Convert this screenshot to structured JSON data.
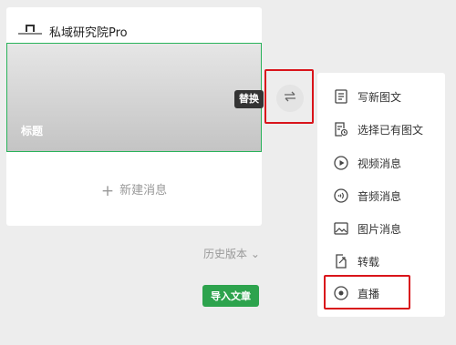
{
  "account": {
    "name": "私域研究院Pro"
  },
  "article": {
    "cover_title": "标题"
  },
  "new_message": {
    "label": "新建消息",
    "icon": "plus-icon"
  },
  "history": {
    "label": "历史版本 ⌄"
  },
  "import_button": {
    "label": "导入文章"
  },
  "swap": {
    "tooltip": "替换",
    "icon": "swap-arrows-icon"
  },
  "menu": {
    "items": [
      {
        "label": "写新图文",
        "icon": "document-icon"
      },
      {
        "label": "选择已有图文",
        "icon": "document-search-icon"
      },
      {
        "label": "视频消息",
        "icon": "play-circle-icon"
      },
      {
        "label": "音频消息",
        "icon": "audio-icon"
      },
      {
        "label": "图片消息",
        "icon": "image-icon"
      },
      {
        "label": "转载",
        "icon": "share-icon"
      },
      {
        "label": "直播",
        "icon": "live-icon"
      }
    ]
  },
  "colors": {
    "accent": "#2da34d",
    "highlight": "#d9141b",
    "selected_border": "#29b35a"
  }
}
